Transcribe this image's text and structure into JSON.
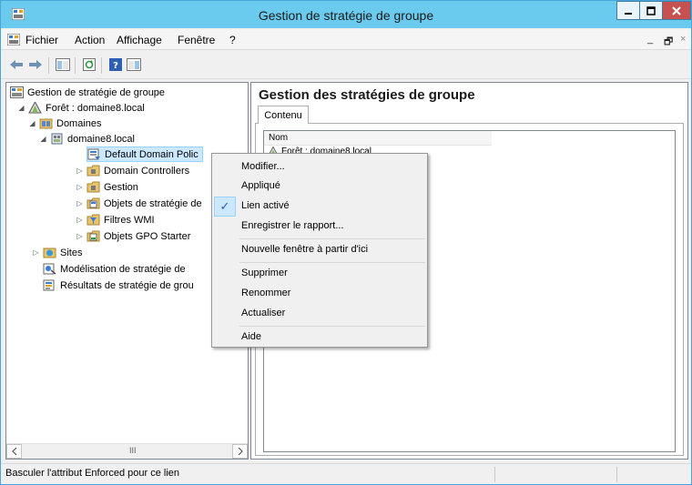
{
  "window": {
    "title": "Gestion de stratégie de groupe"
  },
  "menubar": {
    "items": [
      "Fichier",
      "Action",
      "Affichage",
      "Fenêtre",
      "?"
    ],
    "mdi_controls": [
      "_",
      "🗗",
      "×"
    ]
  },
  "toolbar": {
    "buttons": [
      "back-icon",
      "forward-icon",
      "show-hide-tree-icon",
      "refresh-icon",
      "help-icon",
      "show-action-pane-icon"
    ]
  },
  "tree": {
    "items": [
      {
        "label": "Gestion de stratégie de groupe",
        "icon": "gpmc-root-icon",
        "expander": ""
      },
      {
        "label": "Forêt : domaine8.local",
        "icon": "forest-icon",
        "expander": "◢"
      },
      {
        "label": "Domaines",
        "icon": "domains-icon",
        "expander": "◢"
      },
      {
        "label": "domaine8.local",
        "icon": "domain-icon",
        "expander": "◢"
      },
      {
        "label": "Default Domain Polic",
        "icon": "gpo-link-icon",
        "expander": ""
      },
      {
        "label": "Domain Controllers",
        "icon": "ou-icon",
        "expander": "▷"
      },
      {
        "label": "Gestion",
        "icon": "ou-icon",
        "expander": "▷"
      },
      {
        "label": "Objets de stratégie de",
        "icon": "gpo-container-icon",
        "expander": "▷"
      },
      {
        "label": "Filtres WMI",
        "icon": "wmi-filter-icon",
        "expander": "▷"
      },
      {
        "label": "Objets GPO Starter",
        "icon": "starter-gpo-icon",
        "expander": "▷"
      },
      {
        "label": "Sites",
        "icon": "sites-icon",
        "expander": "▷"
      },
      {
        "label": "Modélisation de stratégie de",
        "icon": "modeling-icon",
        "expander": ""
      },
      {
        "label": "Résultats de stratégie de grou",
        "icon": "results-icon",
        "expander": ""
      }
    ],
    "scroll_grip": "III"
  },
  "right_pane": {
    "title": "Gestion des stratégies de groupe",
    "tab": "Contenu",
    "column_header": "Nom",
    "rows": [
      "Forêt : domaine8.local"
    ]
  },
  "context_menu": {
    "items": [
      "Modifier...",
      "Appliqué",
      "Lien activé",
      "Enregistrer le rapport...",
      "Nouvelle fenêtre à partir d'ici",
      "Supprimer",
      "Renommer",
      "Actualiser",
      "Aide"
    ],
    "checked": "Lien activé",
    "check_mark": "✓"
  },
  "statusbar": {
    "text": "Basculer l'attribut Enforced pour ce lien"
  }
}
